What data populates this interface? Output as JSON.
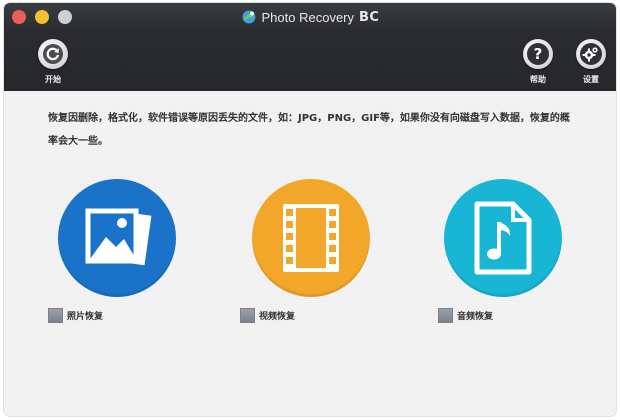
{
  "window": {
    "title": "Photo Recovery",
    "title_suffix": "BC"
  },
  "toolbar": {
    "start_label": "开始",
    "help_label": "帮助",
    "settings_label": "设置"
  },
  "main": {
    "description": "恢复因删除，格式化，软件错误等原因丢失的文件，如：JPG，PNG，GIF等，如果你没有向磁盘写入数据，恢复的概率会大一些。",
    "options": [
      {
        "label": "照片恢复",
        "icon": "photo-icon",
        "color": "#1a73c8",
        "checked": false
      },
      {
        "label": "视频恢复",
        "icon": "film-icon",
        "color": "#f2a72a",
        "checked": false
      },
      {
        "label": "音频恢复",
        "icon": "music-file-icon",
        "color": "#19b5d4",
        "checked": false
      }
    ]
  },
  "colors": {
    "traffic_red": "#ec5f57",
    "traffic_yellow": "#f3bf35",
    "traffic_gray": "#cfd0d2",
    "toolbar_bg": "#2a2c30",
    "content_bg": "#f2f2f2"
  }
}
